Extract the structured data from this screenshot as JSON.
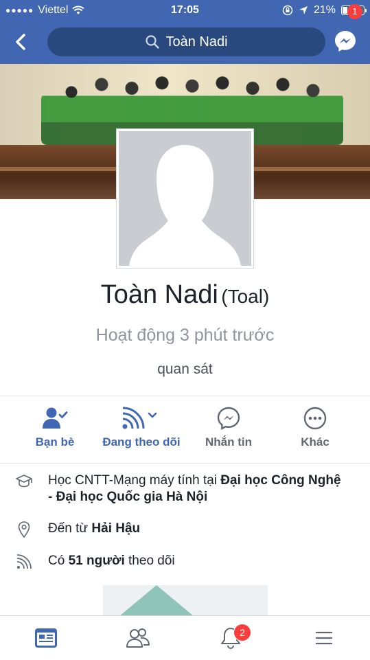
{
  "status_bar": {
    "carrier": "Viettel",
    "time": "17:05",
    "battery": "21%",
    "battery_level": 0.21
  },
  "nav": {
    "search_text": "Toàn Nadi",
    "messenger_badge": "1"
  },
  "profile": {
    "name": "Toàn Nadi",
    "alt_name": "(Toal)",
    "activity": "Hoạt động 3 phút trước",
    "observe_label": "quan sát"
  },
  "actions": [
    {
      "label": "Bạn bè",
      "icon": "friends-check-icon"
    },
    {
      "label": "Đang theo dõi",
      "icon": "following-rss-icon"
    },
    {
      "label": "Nhắn tin",
      "icon": "messenger-icon"
    },
    {
      "label": "Khác",
      "icon": "more-icon"
    }
  ],
  "info": {
    "education": {
      "prefix": "Học CNTT-Mạng máy tính tại ",
      "place": "Đại học Công Nghệ - Đại học Quốc gia Hà Nội"
    },
    "hometown": {
      "prefix": "Đến từ ",
      "place": "Hải Hậu"
    },
    "followers": {
      "prefix": "Có ",
      "count": "51 người",
      "suffix": " theo dõi"
    }
  },
  "tabbar": {
    "notifications_badge": "2",
    "tabs": [
      "news-feed-icon",
      "friends-icon",
      "notifications-icon",
      "menu-icon"
    ]
  },
  "colors": {
    "brand": "#4267b2",
    "badge": "#fa3e3e"
  }
}
